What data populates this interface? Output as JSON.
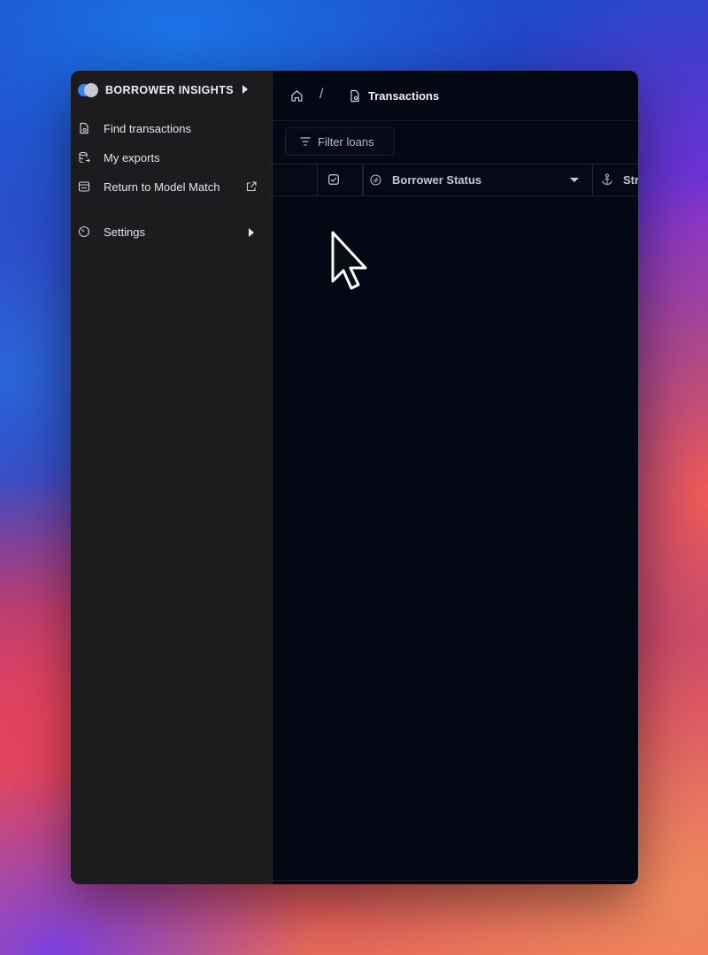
{
  "sidebar": {
    "brand": "BORROWER INSIGHTS",
    "items": [
      {
        "label": "Find transactions",
        "icon": "document-search-icon"
      },
      {
        "label": "My exports",
        "icon": "database-export-icon"
      },
      {
        "label": "Return to Model Match",
        "icon": "window-icon",
        "trailing_icon": "external-link-icon"
      },
      {
        "label": "Settings",
        "icon": "gauge-icon",
        "trailing_icon": "chevron-right-icon"
      }
    ]
  },
  "breadcrumb": {
    "home_icon": "home-icon",
    "separator": "/",
    "current": "Transactions"
  },
  "toolbar": {
    "filter_label": "Filter loans",
    "filter_icon": "filter-lines-icon"
  },
  "table": {
    "columns": [
      {
        "label": "",
        "icon": "checkbox-icon"
      },
      {
        "label": "Borrower Status",
        "icon": "status-icon"
      },
      {
        "label": "Str",
        "icon": "anchor-icon"
      }
    ]
  },
  "colors": {
    "sidebar_bg": "#1c1c1e",
    "main_bg": "#030814",
    "brand_logo_blue": "#3b82f6",
    "brand_logo_gray": "#c7c9d1"
  }
}
